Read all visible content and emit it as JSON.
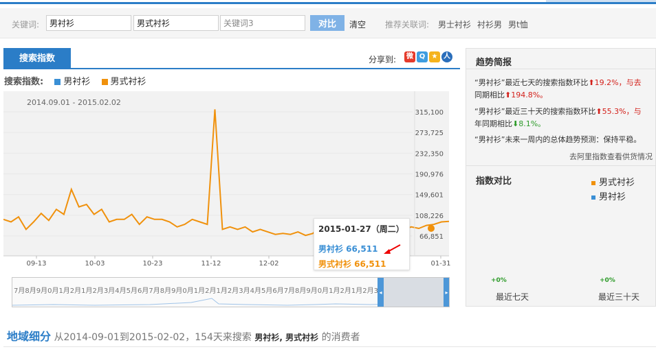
{
  "search": {
    "keyword_label": "关键词:",
    "kw1": "男衬衫",
    "kw2": "男式衬衫",
    "kw3_placeholder": "关键词3",
    "compare": "对比",
    "clear": "清空",
    "rec_label": "推荐关联词:",
    "rec": [
      "男士衬衫",
      "衬衫男",
      "男t恤"
    ]
  },
  "tab": {
    "label": "搜索指数",
    "share": "分享到:"
  },
  "share_icons": [
    "weibo-icon",
    "qzone-icon",
    "star-icon",
    "renren-icon"
  ],
  "legend": {
    "title": "搜索指数:",
    "s1": "男衬衫",
    "s2": "男式衬衫"
  },
  "colors": {
    "blue": "#3a8fd5",
    "orange": "#f0910c",
    "accent": "#2b7dc7"
  },
  "chart_data": {
    "type": "line",
    "date_range": "2014.09.01 - 2015.02.02",
    "y_ticks": [
      "315,100",
      "273,725",
      "232,350",
      "190,976",
      "149,601",
      "108,226",
      "66,851"
    ],
    "x_ticks": [
      "09-13",
      "10-03",
      "10-23",
      "11-12",
      "12-02",
      "01-31"
    ],
    "ylim": [
      66851,
      315100
    ],
    "series": [
      {
        "name": "男衬衫",
        "color": "#3a8fd5",
        "values": []
      },
      {
        "name": "男式衬衫",
        "color": "#f0910c",
        "values": [
          100000,
          95000,
          105000,
          80000,
          95000,
          112000,
          98000,
          120000,
          110000,
          160000,
          125000,
          130000,
          110000,
          120000,
          95000,
          100000,
          100000,
          110000,
          90000,
          105000,
          100000,
          100000,
          95000,
          85000,
          90000,
          100000,
          95000,
          90000,
          320000,
          80000,
          85000,
          80000,
          85000,
          75000,
          80000,
          75000,
          70000,
          72000,
          70000,
          75000,
          68000,
          72000,
          90000,
          66000,
          68000,
          65000,
          70000,
          68000,
          70000,
          72000,
          75000,
          78000,
          72000,
          80000,
          85000,
          82000,
          88000,
          90000,
          95000,
          96000
        ]
      }
    ]
  },
  "tooltip": {
    "date": "2015-01-27（周二）",
    "r1": "男衬衫 66,511",
    "r2": "男式衬衫 66,511"
  },
  "navigator": {
    "ticks": "7月8月9月0月1月2月1月2月3月4月5月6月7月8月9月0月1月2月1月2月3月4月5月6月7月8月9月0月1月2月1月2月3月4月5月6月7月8月9月0月1月2月1月2月3月4月5月6月7月8月9月0月1月2月"
  },
  "panel": {
    "title": "趋势简报",
    "line1a": "“男衬衫”最近七天的搜索指数环比",
    "line1b": "19.2%，与去",
    "line2a": "同期相比",
    "line2b": "194.8%。",
    "line3a": "“男衬衫”最近三十天的搜索指数环比",
    "line3b": "55.3%，与",
    "line4a": "年同期相比",
    "line4b": "8.1%。",
    "line5": "“男衬衫”未来一周内的总体趋势预测：保持平稳。",
    "ali": "去阿里指数查看供货情况",
    "compare_title": "指数对比",
    "leg1": "男式衬衫",
    "leg2": "男衬衫",
    "pct1": "+0%",
    "pct2": "+0%",
    "per1": "最近七天",
    "per2": "最近三十天"
  },
  "region": {
    "title": "地域细分",
    "text1": "从2014-09-01到2015-02-02，154天来搜索",
    "kws": "男衬衫, 男式衬衫",
    "text2": "的消费者"
  }
}
